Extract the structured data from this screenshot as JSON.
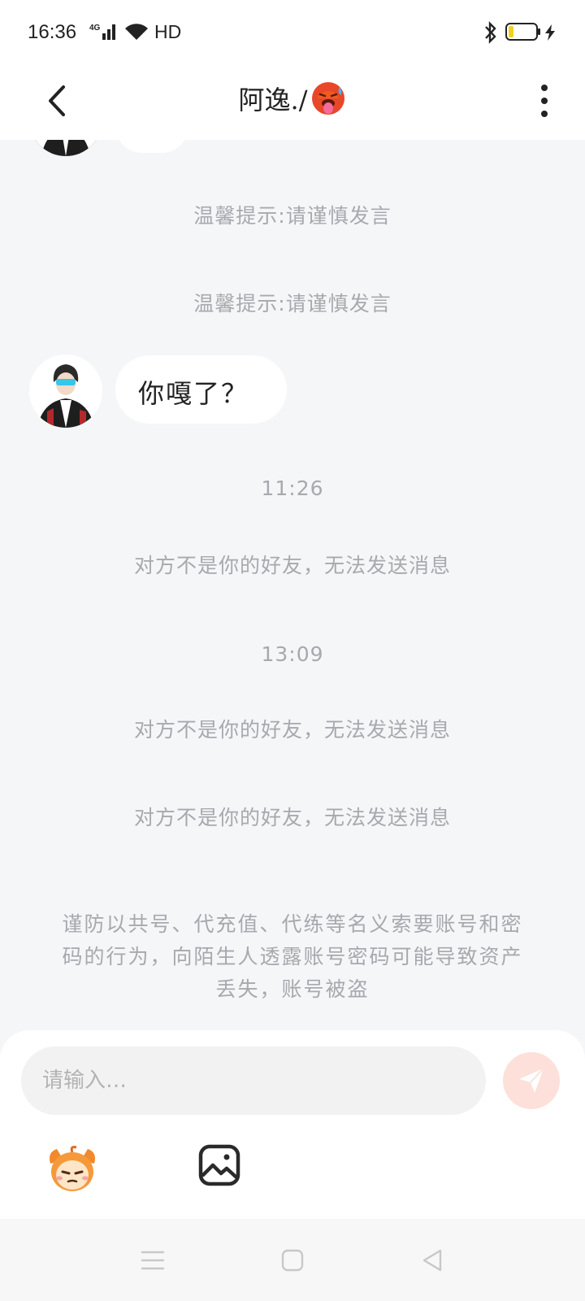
{
  "status_bar": {
    "time": "16:36",
    "network": "4G",
    "hd": "HD"
  },
  "header": {
    "title": "阿逸./",
    "emoji": "hot-face-emoji"
  },
  "chat": {
    "system_tips": [
      "温馨提示:请谨慎发言",
      "温馨提示:请谨慎发言"
    ],
    "message": "你嘎了？",
    "time1": "11:26",
    "notice1": "对方不是你的好友，无法发送消息",
    "time2": "13:09",
    "notice2": "对方不是你的好友，无法发送消息",
    "notice3": "对方不是你的好友，无法发送消息",
    "warning": "谨防以共号、代充值、代练等名义索要账号和密码的行为，向陌生人透露账号密码可能导致资产丢失，账号被盗"
  },
  "composer": {
    "placeholder": "请输入…",
    "send_icon": "paper-plane-icon",
    "tools": [
      "sticker-icon",
      "image-icon"
    ]
  },
  "colors": {
    "background": "#f5f6f8",
    "system_text": "#a7a9ae",
    "send_button": "#fde0da",
    "send_arrow": "#ffffff"
  }
}
